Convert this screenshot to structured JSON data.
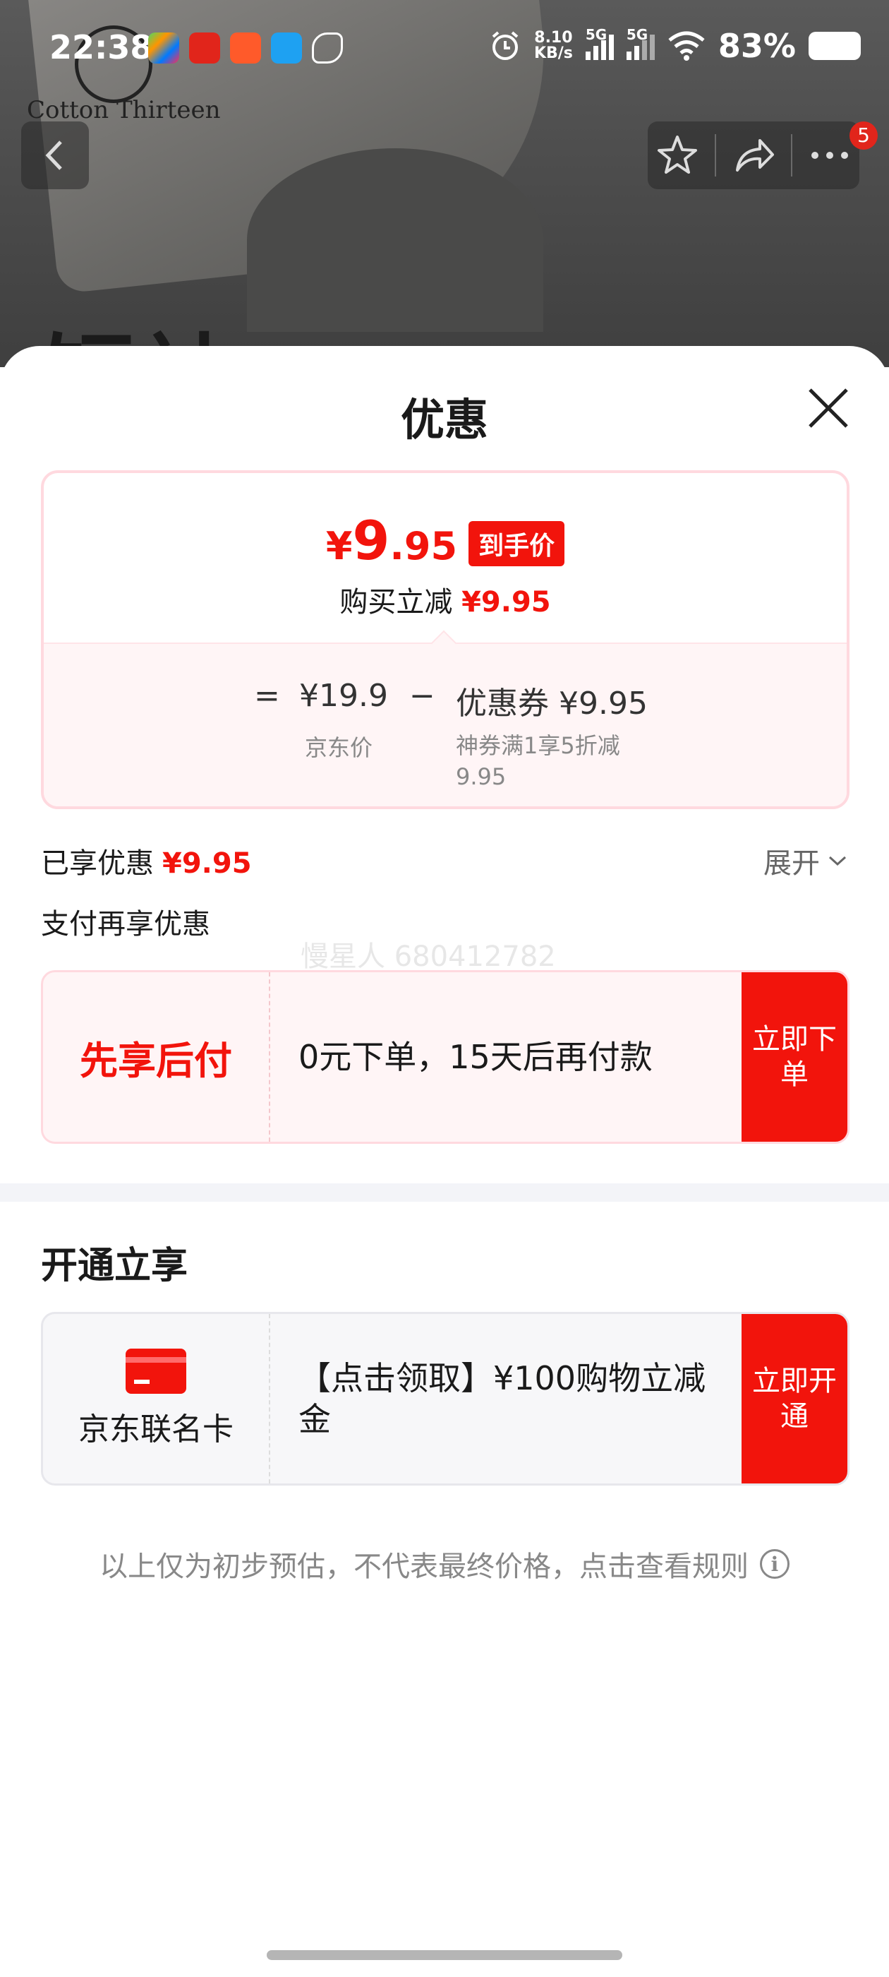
{
  "status_bar": {
    "time": "22:38",
    "net_speed_value": "8.10",
    "net_speed_unit": "KB/s",
    "sig1_label": "5G",
    "sig2_label": "5G",
    "battery": "83%",
    "app_icons": [
      "colorful-app-icon",
      "zhi-app-icon",
      "man-app-icon",
      "blue-app-icon",
      "bird-app-icon"
    ]
  },
  "background_page": {
    "brand_name": "Cotton Thirteen",
    "headline_partial": "短袖"
  },
  "top_nav": {
    "badge_count": "5"
  },
  "sheet": {
    "title": "优惠",
    "price_card": {
      "final_price_symbol": "¥",
      "final_price_int": "9",
      "final_price_dec": ".95",
      "final_price_tag": "到手价",
      "reduce_label": "购买立减",
      "reduce_amount": "¥9.95",
      "formula_eq": "=",
      "jd_price": "¥19.9",
      "formula_minus": "−",
      "coupon_label": "优惠券 ¥9.95",
      "jd_price_label": "京东价",
      "coupon_desc": "神券满1享5折减9.95"
    },
    "enjoyed_label": "已享优惠",
    "enjoyed_amount": "¥9.95",
    "expand_label": "展开",
    "pay_more_label": "支付再享优惠",
    "watermark": "慢星人 680412782",
    "bnpl": {
      "title": "先享后付",
      "desc": "0元下单，15天后再付款",
      "button": "立即下单"
    },
    "section_title": "开通立享",
    "card_offer": {
      "title": "京东联名卡",
      "desc": "【点击领取】¥100购物立减金",
      "button": "立即开通"
    },
    "disclaimer": "以上仅为初步预估，不代表最终价格，点击查看规则"
  },
  "colors": {
    "accent_red": "#f2140c",
    "pink_border": "#ffd9df",
    "pink_bg": "#fff5f6"
  }
}
